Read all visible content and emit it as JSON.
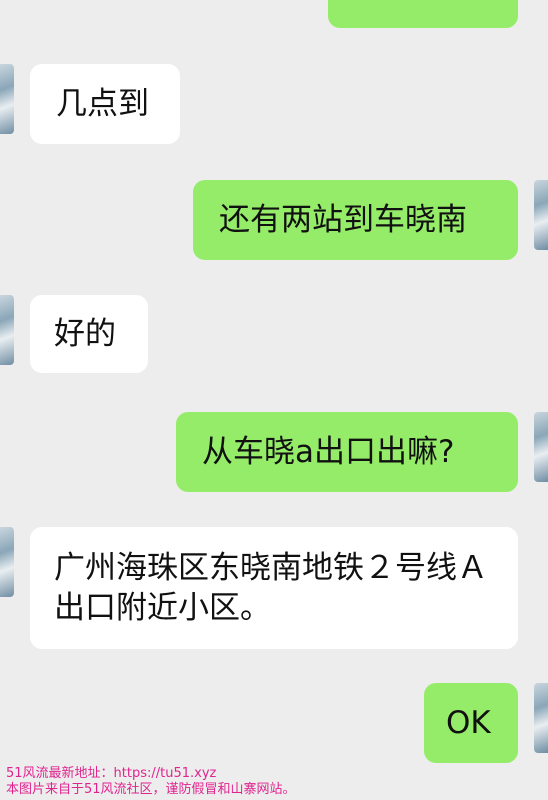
{
  "messages": [
    {
      "side": "in",
      "text": "几点到"
    },
    {
      "side": "out",
      "text": "还有两站到车晓南"
    },
    {
      "side": "in",
      "text": "好的"
    },
    {
      "side": "out",
      "text": "从车晓a出口出嘛?"
    },
    {
      "side": "in",
      "line1": "广州海珠区东晓南地铁２号线Ａ",
      "line2": "出口附近小区。"
    },
    {
      "side": "out",
      "text": "OK"
    }
  ],
  "watermark": {
    "line1": "51风流最新地址：https://tu51.xyz",
    "line2": "本图片来自于51风流社区，谨防假冒和山寨网站。"
  },
  "colors": {
    "background": "#ededed",
    "incoming_bubble": "#ffffff",
    "outgoing_bubble": "#95ec69",
    "watermark": "#e0248f"
  }
}
